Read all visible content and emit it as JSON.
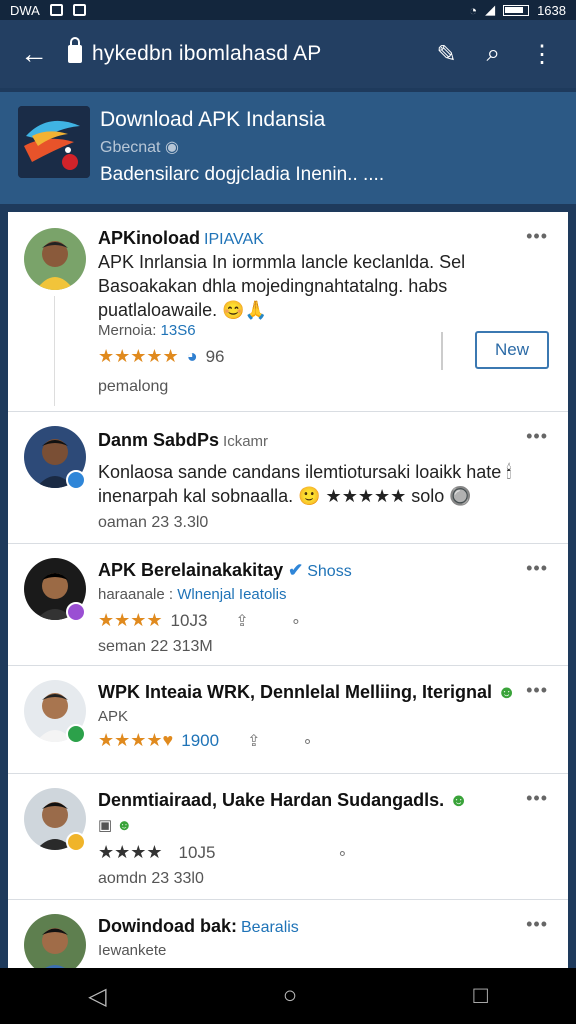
{
  "status": {
    "carrier": "DWA",
    "time": "1638"
  },
  "urlbar": {
    "url": "hykedbn ibomlahasd AP"
  },
  "header": {
    "title": "Download APK Indansia",
    "subtitle": "Gbecnat",
    "description": "Badensilarc dogjcladia Inenin.. ...."
  },
  "posts": [
    {
      "name": "APKinoload",
      "tag": "IPIAVAK",
      "body": "APK Inrlansia In iormmla lancle keclanlda. Sel Basoakakan dhla mojedingnahtatalng. habs puatlaloawaile. 😊🙏",
      "meta_label": "Mernoia:",
      "meta_link": "13S6",
      "stars": "★★★★★",
      "count": "96",
      "time": "pemalong",
      "button": "New"
    },
    {
      "name": "Danm SabdPs",
      "muted": "Ickamr",
      "body": "Konlaosa sande candans ilemtiotursaki loaikk hate 🕯 inenarpah kal sobnaalla. 🙂 ★★★★★ solo 🔘",
      "time": "oaman 23 3.3l0"
    },
    {
      "name": "APK Berelainakakitay",
      "tag": "Shoss",
      "meta_label": "haraanale :",
      "meta_link": "Wlnenjal Ieatolis",
      "stars": "★★★★",
      "count": "10J3",
      "time": "seman 22 313M"
    },
    {
      "name": "WPK Inteaia WRK, Dennlelal Melliing, Iterignal",
      "meta_label": "APK",
      "stars": "★★★★♥",
      "count": "1900"
    },
    {
      "name": "Denmtiairaad, Uake Hardan Sudangadls.",
      "stars": "★★★★",
      "count": "10J5",
      "time": "aomdn 23 33l0"
    },
    {
      "name": "Dowindoad bak:",
      "tag": "Bearalis",
      "meta_label": "Iewankete"
    }
  ],
  "more_glyph": "•••"
}
